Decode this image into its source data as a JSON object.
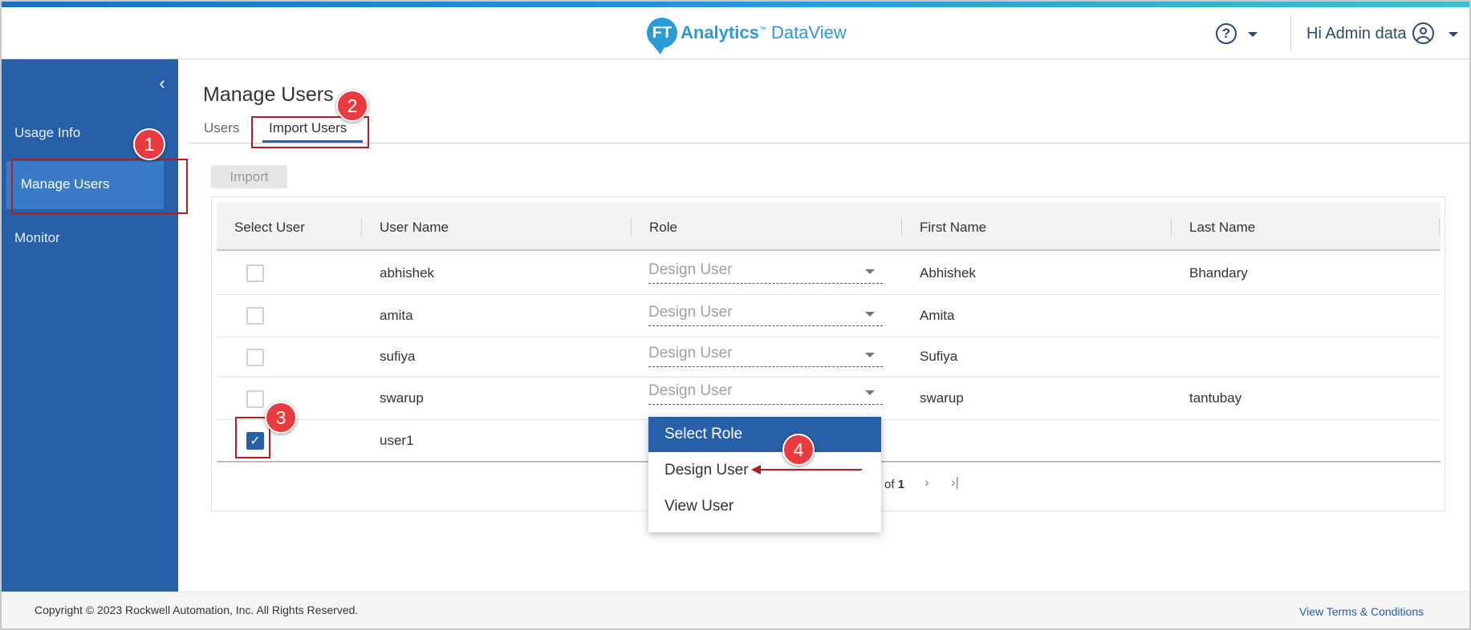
{
  "header": {
    "logo_mark": "FT",
    "logo_brand": "Analytics",
    "logo_tm": "™",
    "logo_product": "DataView",
    "help_glyph": "?",
    "greeting": "Hi Admin data",
    "accent_colors": [
      "#1e6fb8",
      "#3cc1cf"
    ]
  },
  "sidebar": {
    "collapse_glyph": "‹",
    "items": [
      {
        "label": "Usage Info"
      },
      {
        "label": "Manage Users",
        "active": true
      },
      {
        "label": "Monitor"
      }
    ],
    "background": "#2760a8"
  },
  "main": {
    "title": "Manage Users",
    "tabs": [
      {
        "label": "Users"
      },
      {
        "label": "Import Users",
        "active": true
      }
    ],
    "import_button": "Import",
    "table": {
      "columns": [
        "Select User",
        "User Name",
        "Role",
        "First Name",
        "Last Name"
      ],
      "rows": [
        {
          "selected": false,
          "user_name": "abhishek",
          "role": "Design User",
          "first_name": "Abhishek",
          "last_name": "Bhandary"
        },
        {
          "selected": false,
          "user_name": "amita",
          "role": "Design User",
          "first_name": "Amita",
          "last_name": ""
        },
        {
          "selected": false,
          "user_name": "sufiya",
          "role": "Design User",
          "first_name": "Sufiya",
          "last_name": ""
        },
        {
          "selected": false,
          "user_name": "swarup",
          "role": "Design User",
          "first_name": "swarup",
          "last_name": "tantubay"
        },
        {
          "selected": true,
          "user_name": "user1",
          "role": "",
          "first_name": "",
          "last_name": ""
        }
      ],
      "check_glyph": "✓"
    },
    "pager": {
      "of_label": "of",
      "total_pages": "1",
      "next_glyph": "›",
      "last_glyph": "›|"
    },
    "role_dropdown": {
      "options": [
        "Select Role",
        "Design User",
        "View User"
      ],
      "highlighted": "Select Role"
    }
  },
  "footer": {
    "copyright": "Copyright © 2023 Rockwell Automation, Inc. All Rights Reserved.",
    "terms_link": "View Terms & Conditions"
  },
  "callouts": [
    "1",
    "2",
    "3",
    "4"
  ],
  "callout_color": "#b01e23"
}
